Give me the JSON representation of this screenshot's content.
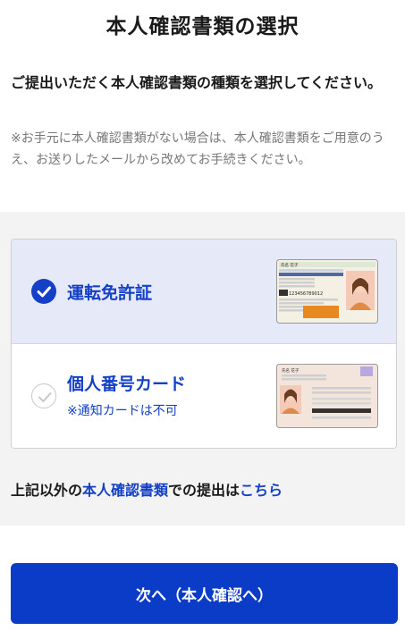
{
  "header": {
    "title": "本人確認書類の選択"
  },
  "intro": {
    "lead": "ご提出いただく本人確認書類の種類を選択してください。",
    "note": "※お手元に本人確認書類がない場合は、本人確認書類をご用意のうえ、お送りしたメールから改めてお手続きください。"
  },
  "options": [
    {
      "label": "運転免許証",
      "selected": true
    },
    {
      "label": "個人番号カード",
      "sub": "※通知カードは不可",
      "selected": false
    }
  ],
  "license_card": {
    "name_text": "氏名 花子",
    "number_text": "123456789012"
  },
  "mynumber_card": {
    "name_text": "氏名 花子"
  },
  "other_link": {
    "prefix": "上記以外の",
    "highlight": "本人確認書類",
    "middle": "での提出は",
    "link": "こちら"
  },
  "next_button": {
    "label": "次へ（本人確認へ）"
  },
  "colors": {
    "accent": "#1440c8",
    "selected_bg": "#e6eaf8",
    "button": "#0a3cc8"
  }
}
